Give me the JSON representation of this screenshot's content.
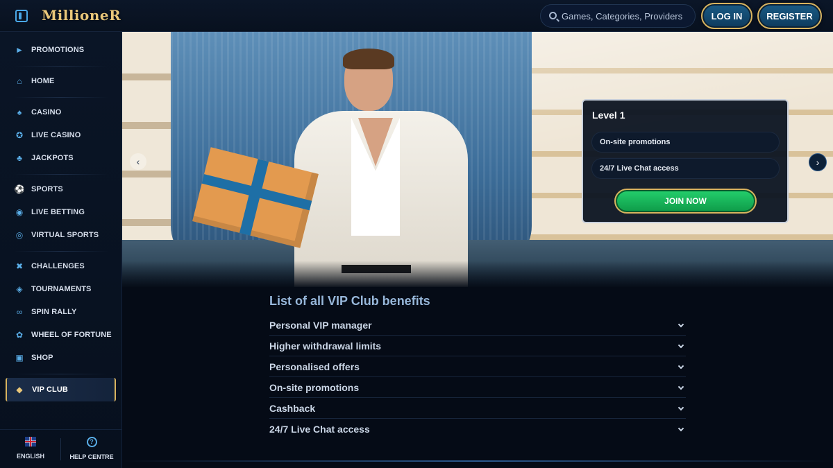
{
  "header": {
    "logo": "MillioneR",
    "search_placeholder": "Games, Categories, Providers",
    "login_label": "LOG IN",
    "register_label": "REGISTER"
  },
  "sidebar": {
    "items": [
      {
        "label": "PROMOTIONS",
        "icon": "megaphone-icon"
      },
      {
        "label": "HOME",
        "icon": "home-icon"
      },
      {
        "label": "CASINO",
        "icon": "spade-icon"
      },
      {
        "label": "LIVE CASINO",
        "icon": "chip-icon"
      },
      {
        "label": "JACKPOTS",
        "icon": "clover-icon"
      },
      {
        "label": "SPORTS",
        "icon": "soccer-ball-icon"
      },
      {
        "label": "LIVE BETTING",
        "icon": "live-bet-icon"
      },
      {
        "label": "VIRTUAL SPORTS",
        "icon": "globe-icon"
      },
      {
        "label": "CHALLENGES",
        "icon": "crossed-swords-icon"
      },
      {
        "label": "TOURNAMENTS",
        "icon": "medal-icon"
      },
      {
        "label": "SPIN RALLY",
        "icon": "rally-icon"
      },
      {
        "label": "WHEEL OF FORTUNE",
        "icon": "wheel-icon"
      },
      {
        "label": "SHOP",
        "icon": "basket-icon"
      },
      {
        "label": "VIP CLUB",
        "icon": "diamond-icon"
      }
    ],
    "footer": {
      "language": "ENGLISH",
      "help": "HELP CENTRE"
    }
  },
  "hero": {
    "card": {
      "level": "Level 1",
      "perks": [
        "On-site promotions",
        "24/7 Live Chat access"
      ],
      "cta": "JOIN NOW"
    }
  },
  "benefits": {
    "title": "List of all VIP Club benefits",
    "items": [
      "Personal VIP manager",
      "Higher withdrawal limits",
      "Personalised offers",
      "On-site promotions",
      "Cashback",
      "24/7 Live Chat access"
    ]
  },
  "colors": {
    "accent_gold": "#d9b45f",
    "accent_blue": "#5aaee8",
    "cta_green": "#24d06d",
    "background": "#050b16"
  }
}
